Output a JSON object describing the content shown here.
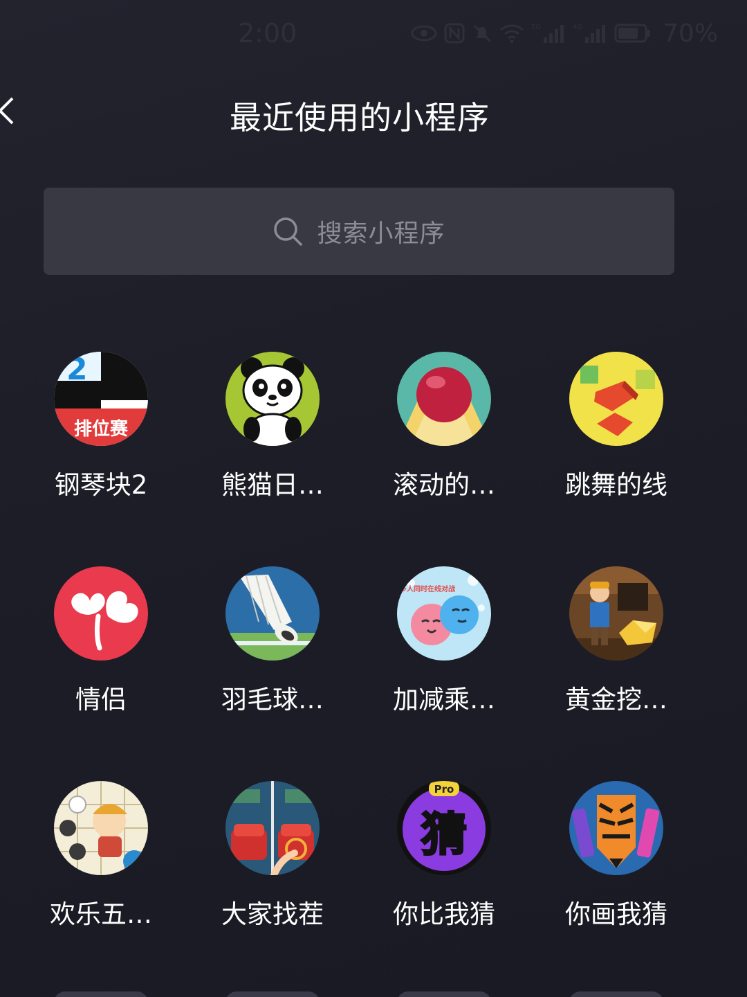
{
  "status_bar": {
    "time": "2:00",
    "battery_text": "70%",
    "icons": [
      "eye-icon",
      "nfc-icon",
      "mute-icon",
      "wifi-icon",
      "signal-5g-icon",
      "signal-4g-icon",
      "battery-icon"
    ]
  },
  "header": {
    "title": "最近使用的小程序",
    "back_icon": "chevron-left-icon"
  },
  "search": {
    "placeholder": "搜索小程序",
    "icon": "search-icon"
  },
  "apps": [
    {
      "label": "钢琴块2",
      "icon": "piano-tiles-icon"
    },
    {
      "label": "熊猫日…",
      "icon": "panda-icon"
    },
    {
      "label": "滚动的…",
      "icon": "rolling-ball-icon"
    },
    {
      "label": "跳舞的线",
      "icon": "dancing-line-icon"
    },
    {
      "label": "情侣",
      "icon": "clover-heart-icon"
    },
    {
      "label": "羽毛球…",
      "icon": "badminton-icon"
    },
    {
      "label": "加减乘…",
      "icon": "bubbles-icon"
    },
    {
      "label": "黄金挖…",
      "icon": "gold-miner-icon"
    },
    {
      "label": "欢乐五…",
      "icon": "gomoku-icon"
    },
    {
      "label": "大家找茬",
      "icon": "spot-difference-icon"
    },
    {
      "label": "你比我猜",
      "icon": "guess-icon"
    },
    {
      "label": "你画我猜",
      "icon": "draw-guess-icon"
    }
  ],
  "icon_text": {
    "piano_number": "2",
    "piano_banner": "排位赛",
    "guess_char": "猜",
    "guess_pro": "Pro",
    "bubbles_tag": "多人同时在线对战"
  },
  "colors": {
    "background": "#1e1e28",
    "search_bg": "#393944",
    "placeholder": "#8c8c96",
    "status_text": "#2f2f3a"
  }
}
